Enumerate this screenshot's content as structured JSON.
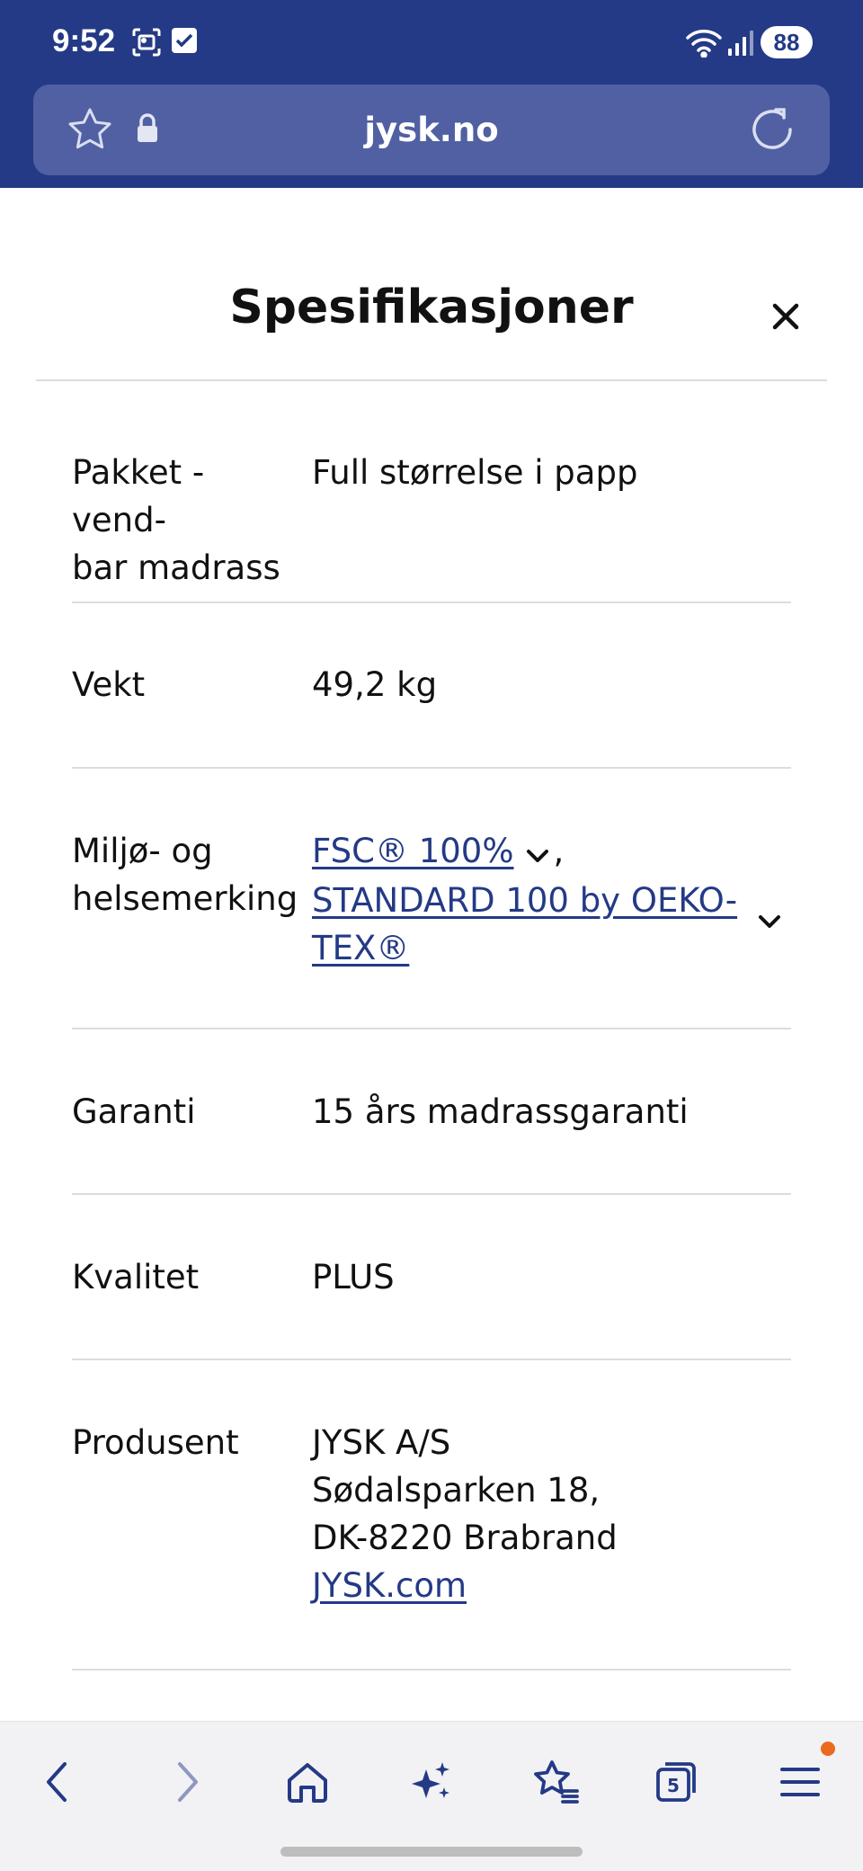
{
  "status_bar": {
    "time": "9:52",
    "battery": "88",
    "icons": [
      "screenshot-icon",
      "checkbox-icon",
      "wifi-icon",
      "signal-icon"
    ]
  },
  "browser": {
    "url": "jysk.no",
    "icons": [
      "star-icon",
      "lock-icon",
      "reload-icon"
    ]
  },
  "sheet": {
    "title": "Spesifikasjoner",
    "close_icon": "close-icon"
  },
  "specs": [
    {
      "label": "Pakket - vend-bar madrass",
      "label_lines": [
        "Pakket - vend-",
        "bar madrass"
      ],
      "value": "Full størrelse i papp"
    },
    {
      "label": "Vekt",
      "value": "49,2 kg"
    },
    {
      "label": "Miljø- og helsemerking",
      "label_lines": [
        "Miljø- og",
        "helsemerking"
      ],
      "links": [
        {
          "text": "FSC® 100%"
        },
        {
          "text": "STANDARD 100 by OEKO-TEX®",
          "lines": [
            "STANDARD 100 by OEKO-",
            "TEX®"
          ]
        }
      ],
      "separator": ","
    },
    {
      "label": "Garanti",
      "value": "15 års madrassgaranti"
    },
    {
      "label": "Kvalitet",
      "value": "PLUS"
    },
    {
      "label": "Produsent",
      "value_lines": [
        "JYSK A/S",
        "Sødalsparken 18,",
        "DK-8220 Brabrand"
      ],
      "link": "JYSK.com"
    }
  ],
  "toolbar": {
    "items": [
      "back-icon",
      "forward-icon",
      "home-icon",
      "sparkles-icon",
      "favorites-icon",
      "tabs-icon",
      "menu-icon"
    ],
    "tab_count": "5"
  },
  "colors": {
    "brand": "#243a86",
    "url_bar": "#5160a3",
    "link": "#243a86",
    "divider": "#dcdcdc",
    "notification": "#ea6a1e"
  }
}
